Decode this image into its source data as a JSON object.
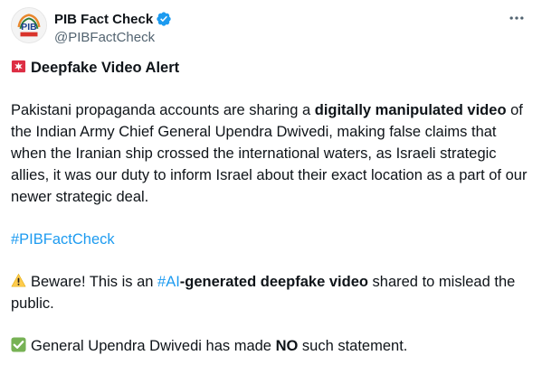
{
  "account": {
    "display_name": "PIB Fact Check",
    "handle": "@PIBFactCheck",
    "avatar_icon": "pib-logo-icon",
    "verified_icon": "verified-badge-icon",
    "more_icon": "more-options-icon"
  },
  "tweet": {
    "alert_icon": "rotating-light-icon",
    "alert_title": "Deepfake Video Alert",
    "para1": {
      "t1": "Pakistani propaganda accounts are sharing a ",
      "b1": "digitally manipulated video",
      "t2": " of the Indian Army Chief General Upendra Dwivedi, making false claims that when the Iranian ship crossed the international waters, as Israeli strategic allies, it was our duty to inform Israel about their exact location as a part of our newer strategic deal."
    },
    "hashtag": "#PIBFactCheck",
    "warning": {
      "icon": "warning-icon",
      "t1": "Beware! This is an ",
      "hashtag": "#AI",
      "b1": "-generated deepfake video",
      "t2": " shared to mislead the public."
    },
    "check": {
      "icon": "check-mark-icon",
      "t1": "General Upendra Dwivedi has made ",
      "b1": "NO",
      "t2": " such statement."
    }
  },
  "colors": {
    "link": "#1d9bf0",
    "text": "#0f1419",
    "secondary": "#536471",
    "verified": "#1d9bf0",
    "alert_red": "#dd2e44",
    "warning_yellow": "#ffcc4d",
    "check_green": "#77b255"
  }
}
